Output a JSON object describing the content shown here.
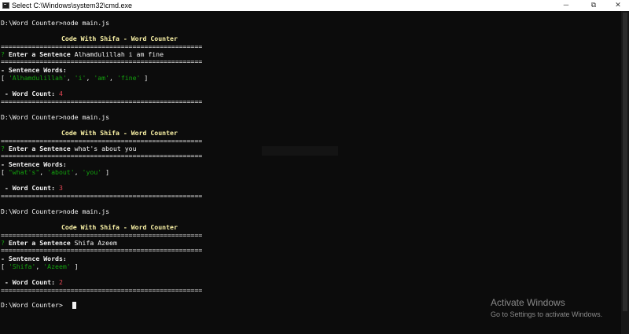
{
  "window": {
    "title": "Select C:\\Windows\\system32\\cmd.exe",
    "minimize_glyph": "─",
    "maximize_glyph": "⧉",
    "close_glyph": "✕"
  },
  "terminal": {
    "prompt": "D:\\Word Counter>",
    "command": "node main.js",
    "banner": "Code With Shifa - Word Counter",
    "separator": "====================================================",
    "question_mark": "?",
    "enter_label": "Enter a Sentence",
    "words_label": "- Sentence Words:",
    "count_label": " - Word Count:",
    "runs": [
      {
        "sentence": "Alhamdulillah i am fine",
        "words": [
          "'Alhamdulillah'",
          "'i'",
          "'am'",
          "'fine'"
        ],
        "count": "4"
      },
      {
        "sentence": "what's about you",
        "words": [
          "\"what's\"",
          "'about'",
          "'you'"
        ],
        "count": "3"
      },
      {
        "sentence": "Shifa Azeem",
        "words": [
          "'Shifa'",
          "'Azeem'"
        ],
        "count": "2"
      }
    ],
    "final_prompt": "D:\\Word Counter>"
  },
  "watermark": {
    "title": "Activate Windows",
    "subtitle": "Go to Settings to activate Windows."
  }
}
